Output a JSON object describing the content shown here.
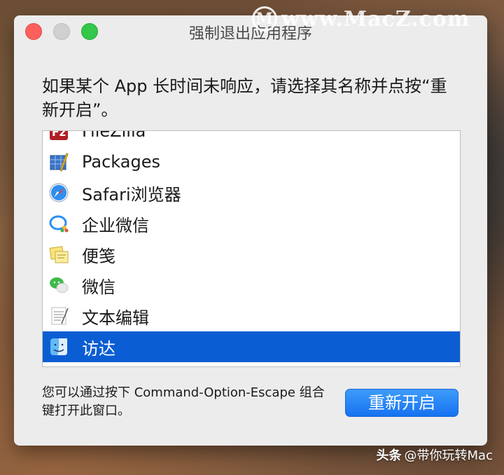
{
  "watermark": {
    "logo_letter": "M",
    "text": "www.MacZ.com"
  },
  "window": {
    "title": "强制退出应用程序",
    "instructions": "如果某个 App 长时间未响应，请选择其名称并点按“重新开启”。",
    "footnote": "您可以通过按下 Command-Option-Escape 组合键打开此窗口。",
    "relaunch_label": "重新开启"
  },
  "app_list": {
    "selected_index": 7,
    "items": [
      {
        "label": "FileZilla",
        "icon": "filezilla-icon"
      },
      {
        "label": "Packages",
        "icon": "packages-icon"
      },
      {
        "label": "Safari浏览器",
        "icon": "safari-icon"
      },
      {
        "label": "企业微信",
        "icon": "wecom-icon"
      },
      {
        "label": "便笺",
        "icon": "stickies-icon"
      },
      {
        "label": "微信",
        "icon": "wechat-icon"
      },
      {
        "label": "文本编辑",
        "icon": "textedit-icon"
      },
      {
        "label": "访达",
        "icon": "finder-icon"
      }
    ]
  },
  "credit": {
    "prefix": "头条",
    "text": "@带你玩转Mac"
  },
  "colors": {
    "selection": "#0b5dd3",
    "button": "#1a7cf5",
    "close": "#fc605c",
    "maximize": "#34c84a",
    "window_bg": "#ececec"
  }
}
